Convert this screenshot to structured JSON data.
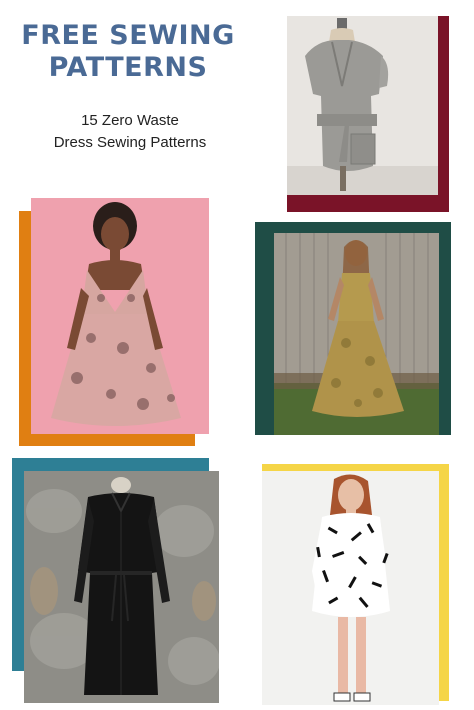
{
  "header": {
    "title_line1": "FREE SEWING",
    "title_line2": "PATTERNS",
    "subtitle_line1": "15 Zero Waste",
    "subtitle_line2": "Dress Sewing Patterns"
  },
  "colors": {
    "title": "#4a6a95",
    "burgundy": "#7a1328",
    "orange": "#e07f12",
    "dark_green": "#1f4d46",
    "teal": "#2e7f95",
    "yellow": "#f5d547",
    "pink": "#efa1ae"
  },
  "photos": [
    {
      "subject": "grey wrap dress with belt and patch pocket on dress form",
      "frame": "burgundy"
    },
    {
      "subject": "woman in pink floral halter sundress",
      "frame": "orange"
    },
    {
      "subject": "woman in olive floral sleeveless dress in garden",
      "frame": "dark_green"
    },
    {
      "subject": "black long-sleeve shirt dress on dress form",
      "frame": "teal"
    },
    {
      "subject": "woman in black and white printed tunic dress",
      "frame": "yellow"
    }
  ]
}
